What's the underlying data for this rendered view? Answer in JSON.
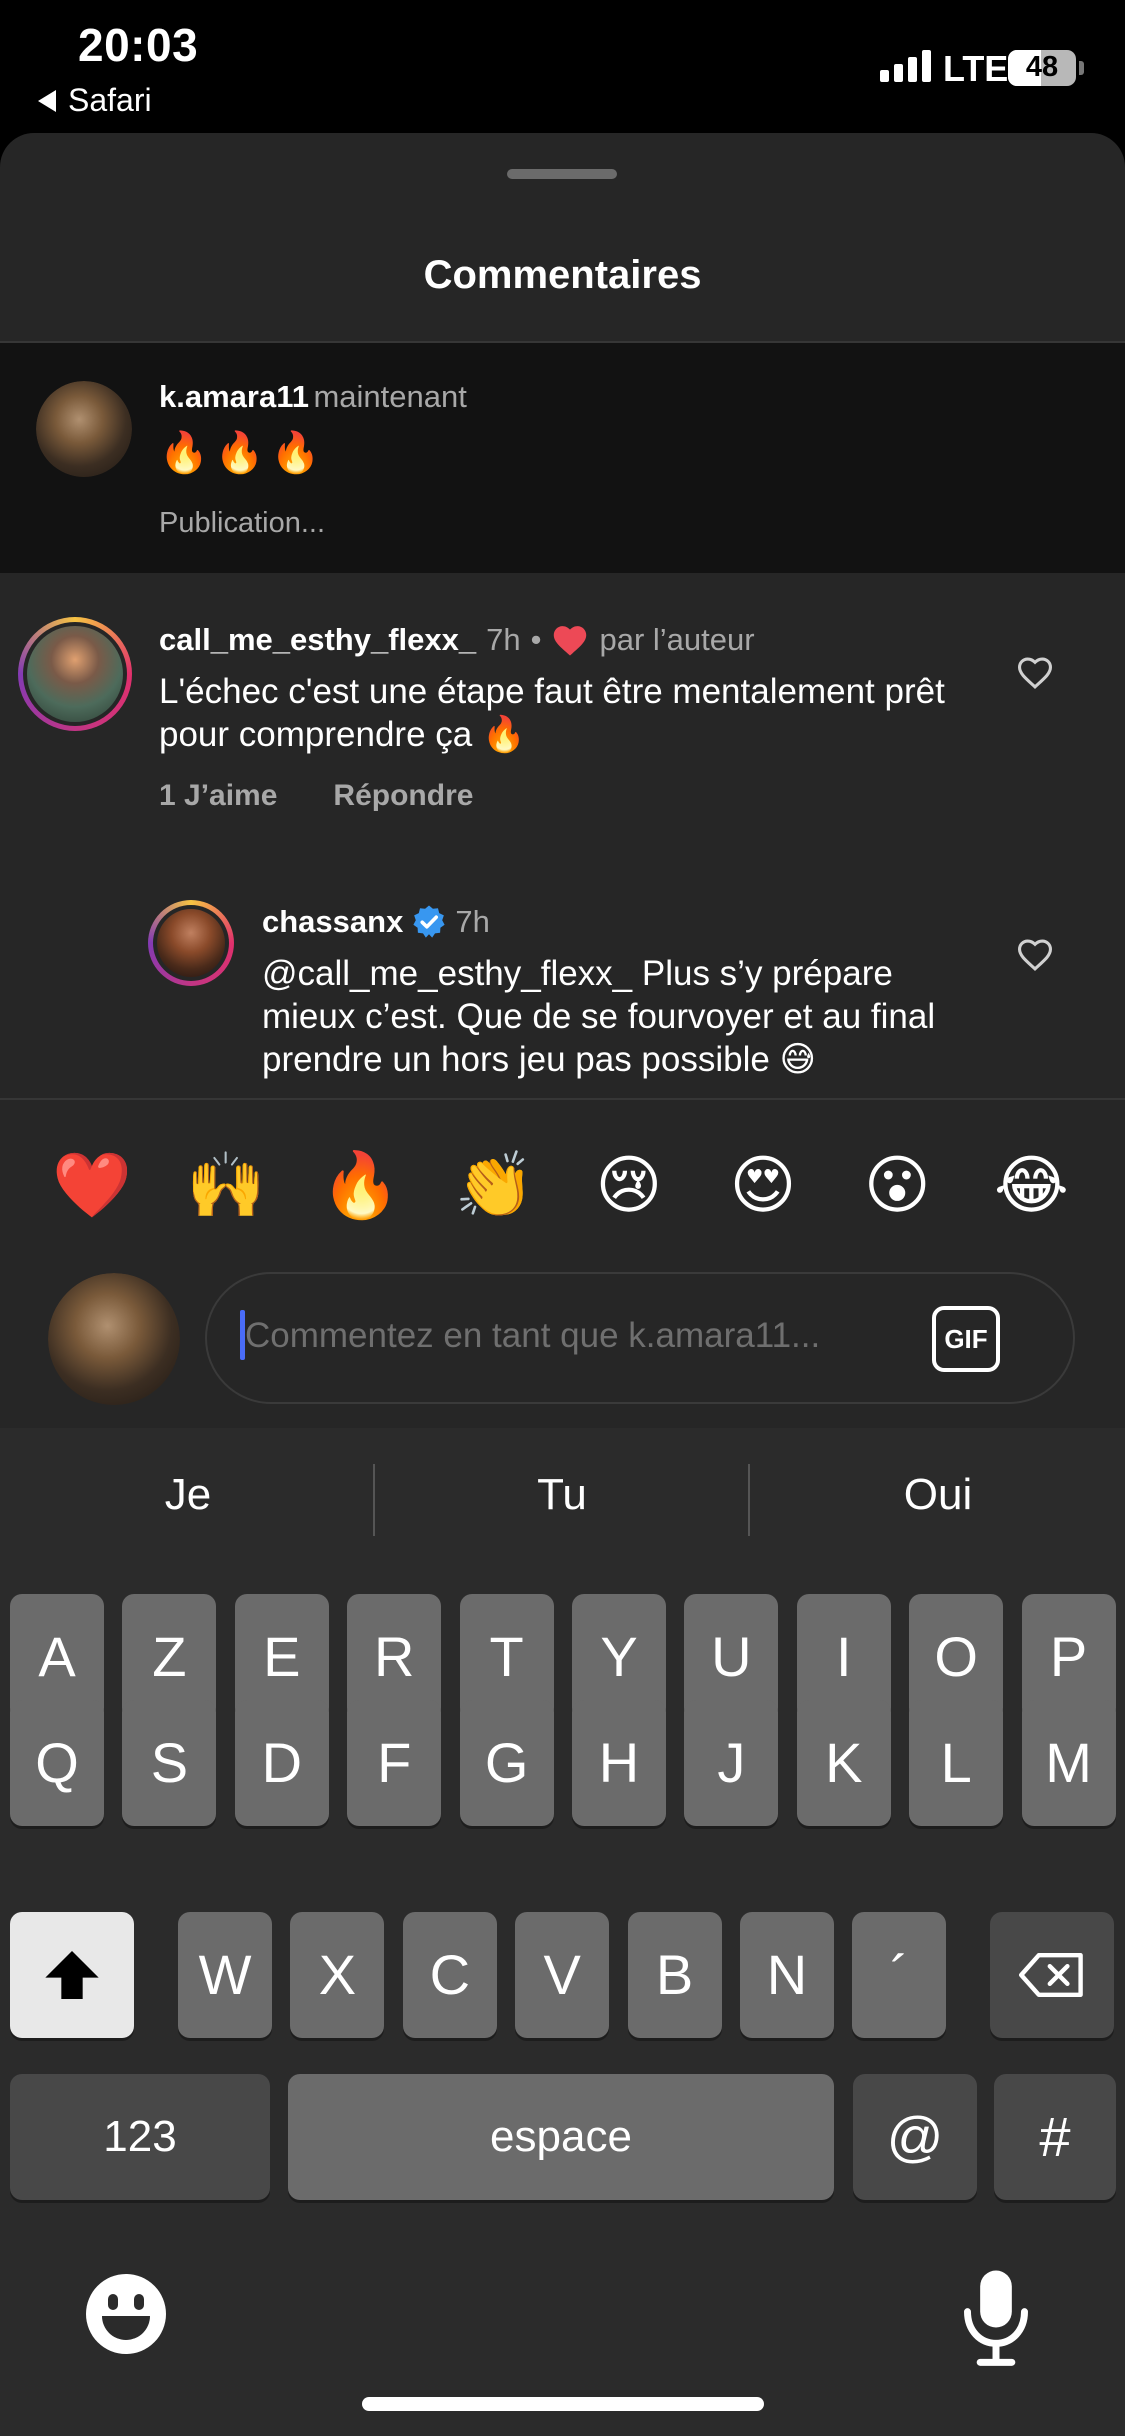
{
  "status_bar": {
    "time": "20:03",
    "back_app": "Safari",
    "network": "LTE",
    "battery": 48
  },
  "sheet": {
    "title": "Commentaires"
  },
  "pending_comment": {
    "username": "k.amara11",
    "time": "maintenant",
    "text": "🔥🔥🔥",
    "status": "Publication..."
  },
  "comments": [
    {
      "username": "call_me_esthy_flexx_",
      "time": "7h",
      "separator": "•",
      "liked_by_author": "par l’auteur",
      "text": "L'échec c'est une étape faut être mentalement prêt pour comprendre ça 🔥",
      "likes": "1 J’aime",
      "reply": "Répondre"
    }
  ],
  "replies": [
    {
      "username": "chassanx",
      "verified": true,
      "time": "7h",
      "text": "@call_me_esthy_flexx_ Plus s’y prépare mieux c’est. Que de se fourvoyer et au final prendre un hors jeu pas possible 😅"
    }
  ],
  "emoji_bar": [
    "❤️",
    "🙌",
    "🔥",
    "👏",
    "😢",
    "😍",
    "😮",
    "😂"
  ],
  "composer": {
    "placeholder": "Commentez en tant que k.amara11...",
    "gif_label": "GIF"
  },
  "keyboard": {
    "suggestions": [
      "Je",
      "Tu",
      "Oui"
    ],
    "row1": [
      "A",
      "Z",
      "E",
      "R",
      "T",
      "Y",
      "U",
      "I",
      "O",
      "P"
    ],
    "row2": [
      "Q",
      "S",
      "D",
      "F",
      "G",
      "H",
      "J",
      "K",
      "L",
      "M"
    ],
    "row3": [
      "W",
      "X",
      "C",
      "V",
      "B",
      "N",
      "´"
    ],
    "numbers_label": "123",
    "space_label": "espace",
    "at_label": "@",
    "hash_label": "#"
  },
  "colors": {
    "sheet_bg": "#262626",
    "pending_bg": "#121212",
    "like_red": "#ed4956",
    "verified_blue": "#3897f0",
    "caret_blue": "#4a6cf7"
  }
}
